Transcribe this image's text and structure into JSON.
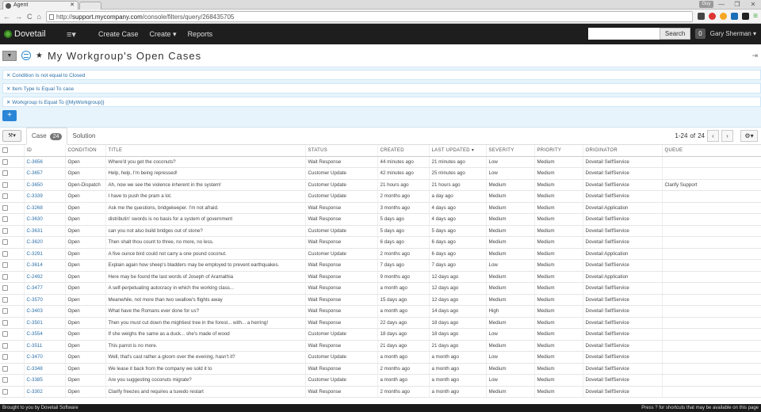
{
  "browser": {
    "tab_title": "Agent",
    "url_prefix": "http://",
    "url_host": "support.mycompany.com",
    "url_path": "/console/filters/query/268435705",
    "user_badge": "Guy"
  },
  "app": {
    "name": "Dovetail",
    "menu": [
      "Create Case",
      "Create ▾",
      "Reports"
    ],
    "search_button": "Search",
    "notif_count": "0",
    "user": "Gary Sherman ▾"
  },
  "page": {
    "title": "My Workgroup's Open Cases"
  },
  "filters": [
    "✕ Condition Is not equal to Closed",
    "✕ Item Type Is Equal To case",
    "✕ Workgroup Is Equal To {{MyWorkgroup}}"
  ],
  "tabs": {
    "case_label": "Case",
    "case_count": "24",
    "solution_label": "Solution"
  },
  "pager": {
    "range": "1-24",
    "of_label": "of",
    "total": "24"
  },
  "columns": [
    "ID",
    "CONDITION",
    "TITLE",
    "STATUS",
    "CREATED",
    "LAST UPDATED ▾",
    "SEVERITY",
    "PRIORITY",
    "ORIGINATOR",
    "QUEUE"
  ],
  "rows": [
    [
      "C-3656",
      "Open",
      "Where'd you get the coconuts?",
      "Wait Response",
      "44 minutes ago",
      "21 minutes ago",
      "Low",
      "Medium",
      "Dovetail SelfService",
      ""
    ],
    [
      "C-3657",
      "Open",
      "Help, help, I'm being repressed!",
      "Customer Update",
      "42 minutes ago",
      "25 minutes ago",
      "Low",
      "Medium",
      "Dovetail SelfService",
      ""
    ],
    [
      "C-3650",
      "Open-Dispatch",
      "Ah, now we see the violence inherent in the system!",
      "Customer Update",
      "21 hours ago",
      "21 hours ago",
      "Medium",
      "Medium",
      "Dovetail SelfService",
      "Clarify Support"
    ],
    [
      "C-3339",
      "Open",
      "I have to push the pram a lot.",
      "Customer Update",
      "2 months ago",
      "a day ago",
      "Medium",
      "Medium",
      "Dovetail SelfService",
      ""
    ],
    [
      "C-3268",
      "Open",
      "Ask me the questions, bridgekeeper. I'm not afraid.",
      "Wait Response",
      "3 months ago",
      "4 days ago",
      "Medium",
      "Medium",
      "Dovetail Application",
      ""
    ],
    [
      "C-3630",
      "Open",
      "distributin' swords is no basis for a system of government",
      "Wait Response",
      "5 days ago",
      "4 days ago",
      "Medium",
      "Medium",
      "Dovetail SelfService",
      ""
    ],
    [
      "C-3631",
      "Open",
      "can you not also build bridges out of stone?",
      "Customer Update",
      "5 days ago",
      "5 days ago",
      "Medium",
      "Medium",
      "Dovetail SelfService",
      ""
    ],
    [
      "C-3620",
      "Open",
      "Then shalt thou count to three, no more, no less.",
      "Wait Response",
      "6 days ago",
      "6 days ago",
      "Medium",
      "Medium",
      "Dovetail SelfService",
      ""
    ],
    [
      "C-3291",
      "Open",
      "A five ounce bird could not carry a one pound coconut.",
      "Customer Update",
      "2 months ago",
      "6 days ago",
      "Medium",
      "Medium",
      "Dovetail Application",
      ""
    ],
    [
      "C-3614",
      "Open",
      "Explain again how sheep's bladders may be employed to prevent earthquakes.",
      "Wait Response",
      "7 days ago",
      "7 days ago",
      "Low",
      "Medium",
      "Dovetail SelfService",
      ""
    ],
    [
      "C-2492",
      "Open",
      "Here may be found the last words of Joseph of Aramathia",
      "Wait Response",
      "9 months ago",
      "12 days ago",
      "Medium",
      "Medium",
      "Dovetail Application",
      ""
    ],
    [
      "C-3477",
      "Open",
      "A self-perpetuating autocracy in which the working class...",
      "Wait Response",
      "a month ago",
      "12 days ago",
      "Medium",
      "Medium",
      "Dovetail SelfService",
      ""
    ],
    [
      "C-3570",
      "Open",
      "Meanwhile, not more than two swallow's flights away",
      "Wait Response",
      "15 days ago",
      "12 days ago",
      "Medium",
      "Medium",
      "Dovetail SelfService",
      ""
    ],
    [
      "C-3403",
      "Open",
      "What have the Romans ever done for us?",
      "Wait Response",
      "a month ago",
      "14 days ago",
      "High",
      "Medium",
      "Dovetail SelfService",
      ""
    ],
    [
      "C-3501",
      "Open",
      "Then you must cut down the mightiest tree in the forest... with... a herring!",
      "Wait Response",
      "22 days ago",
      "18 days ago",
      "Medium",
      "Medium",
      "Dovetail SelfService",
      ""
    ],
    [
      "C-3554",
      "Open",
      "If she weighs the same as a duck... she's made of wood",
      "Customer Update",
      "18 days ago",
      "18 days ago",
      "Low",
      "Medium",
      "Dovetail SelfService",
      ""
    ],
    [
      "C-3511",
      "Open",
      "This parrot is no more.",
      "Wait Response",
      "21 days ago",
      "21 days ago",
      "Medium",
      "Medium",
      "Dovetail SelfService",
      ""
    ],
    [
      "C-3470",
      "Open",
      "Well, that's cast rather a gloom over the evening, hasn't it?",
      "Customer Update",
      "a month ago",
      "a month ago",
      "Low",
      "Medium",
      "Dovetail SelfService",
      ""
    ],
    [
      "C-3348",
      "Open",
      "We lease it back from the company we sold it to",
      "Wait Response",
      "2 months ago",
      "a month ago",
      "Medium",
      "Medium",
      "Dovetail SelfService",
      ""
    ],
    [
      "C-3385",
      "Open",
      "Are you suggesting coconuts migrate?",
      "Customer Update",
      "a month ago",
      "a month ago",
      "Low",
      "Medium",
      "Dovetail SelfService",
      ""
    ],
    [
      "C-3302",
      "Open",
      "Clarify freezes and requires a tuxedo restart",
      "Wait Response",
      "2 months ago",
      "a month ago",
      "Medium",
      "Medium",
      "Dovetail SelfService",
      ""
    ]
  ],
  "statusbar": {
    "left": "Brought to you by Dovetail Software",
    "right": "Press ? for shortcuts that may be available on this page"
  },
  "colors": {
    "topbar": "#1e1e1e",
    "accent": "#2a86d6",
    "filter_bg": "#e7f4fc",
    "link": "#2a6fa8"
  }
}
